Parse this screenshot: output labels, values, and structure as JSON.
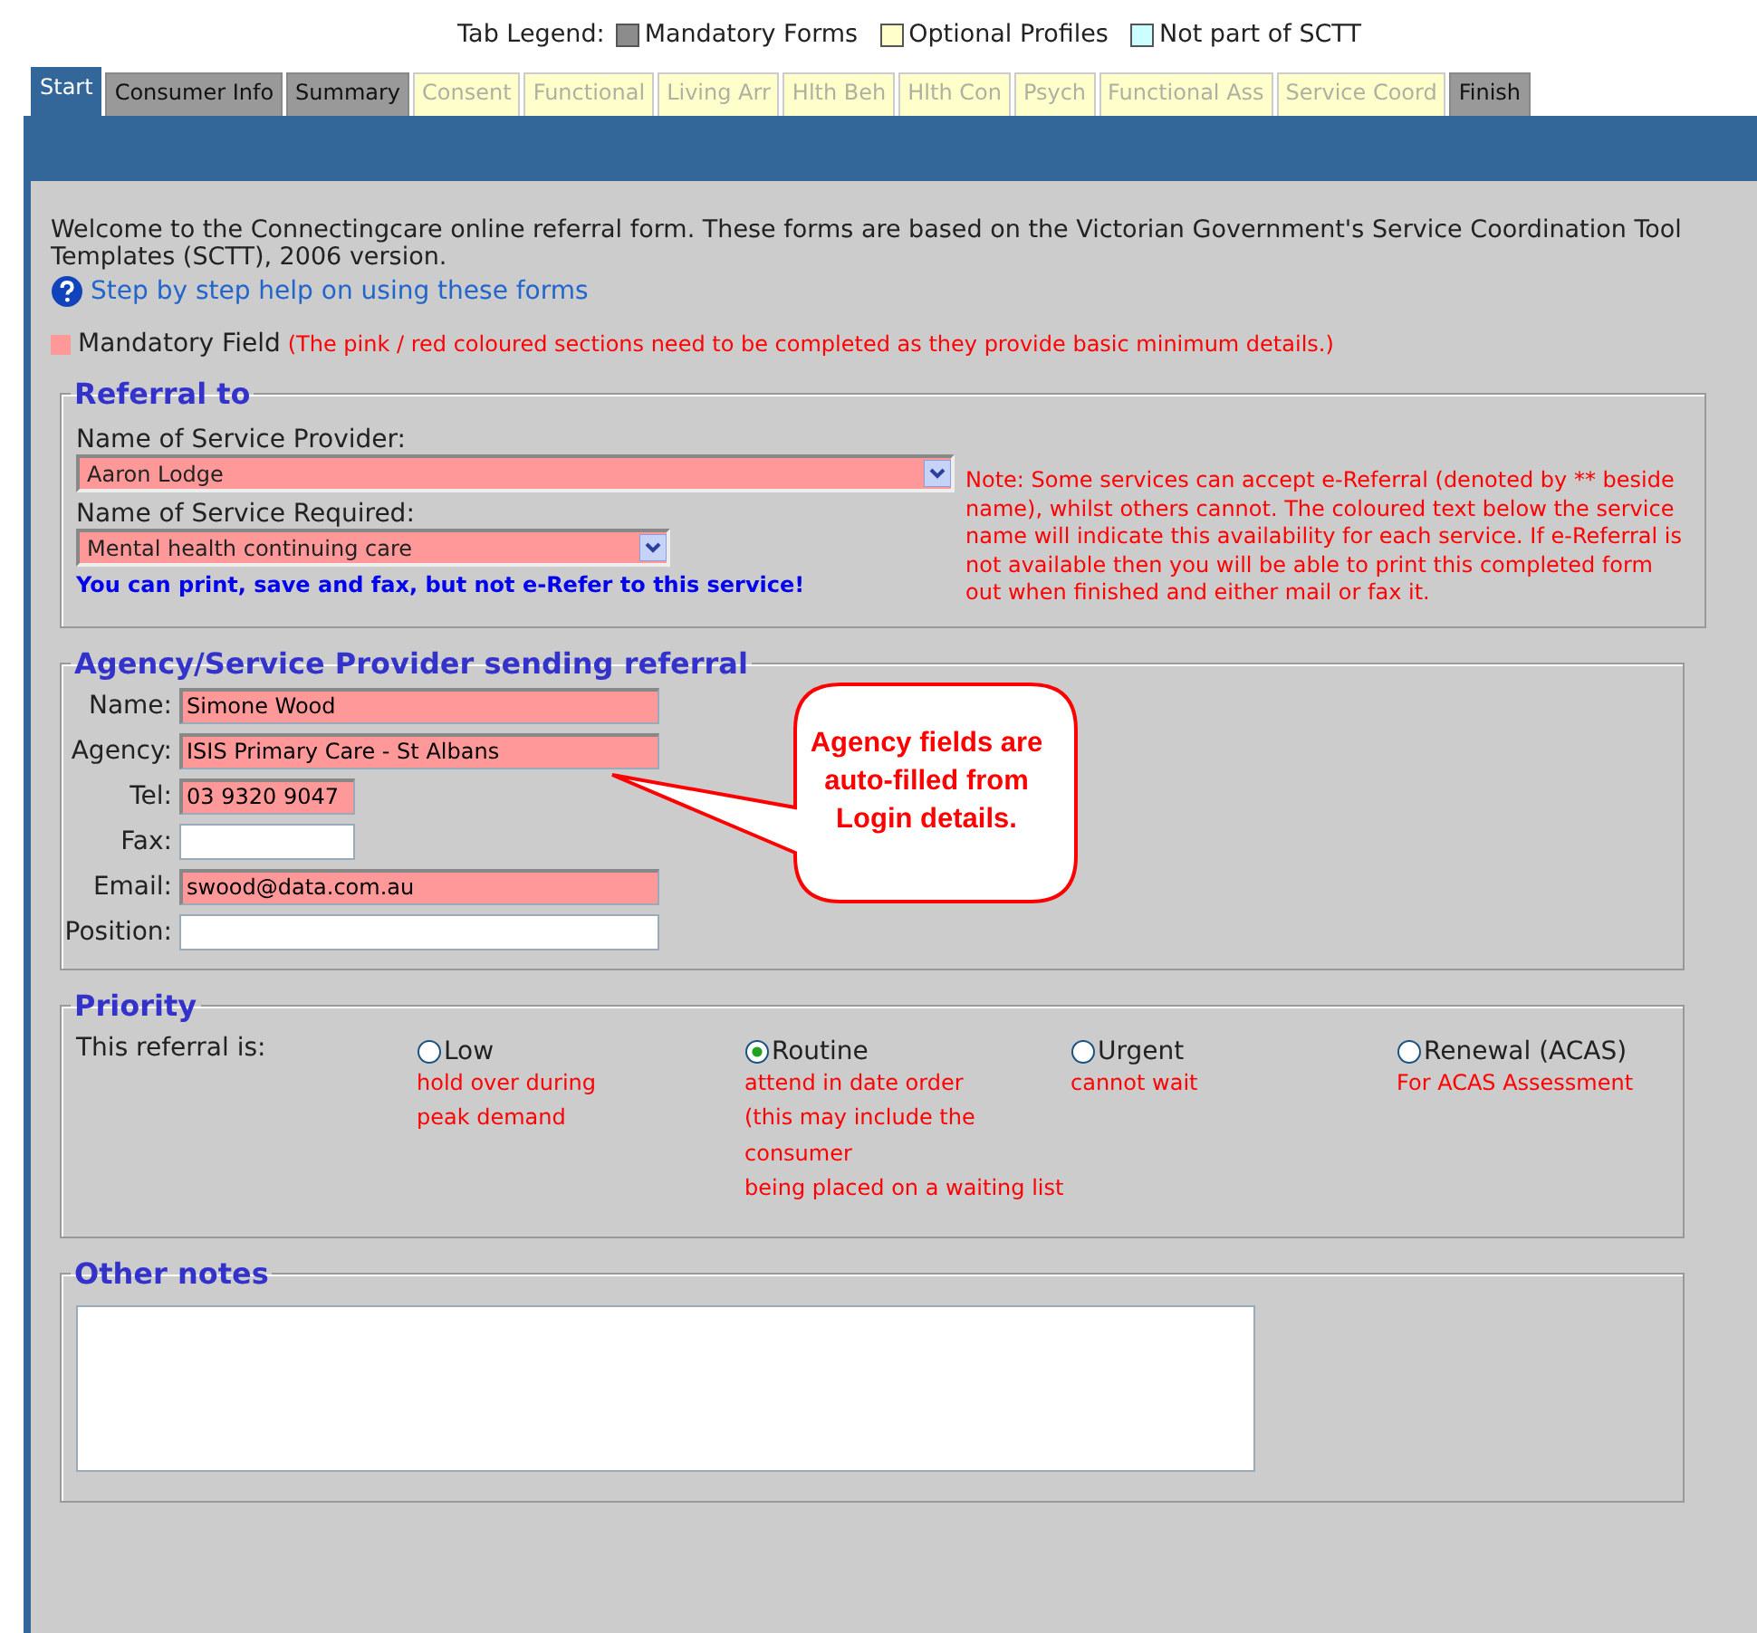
{
  "legend": {
    "label": "Tab Legend:",
    "items": [
      {
        "kind": "mandatory",
        "label": "Mandatory Forms"
      },
      {
        "kind": "optional",
        "label": "Optional Profiles"
      },
      {
        "kind": "external",
        "label": "Not part of SCTT"
      }
    ]
  },
  "tabs": [
    {
      "label": "Start",
      "kind": "mandatory",
      "selected": true
    },
    {
      "label": "Consumer Info",
      "kind": "mandatory",
      "selected": false
    },
    {
      "label": "Summary",
      "kind": "mandatory",
      "selected": false
    },
    {
      "label": "Consent",
      "kind": "optional",
      "selected": false
    },
    {
      "label": "Functional",
      "kind": "optional",
      "selected": false
    },
    {
      "label": "Living Arr",
      "kind": "optional",
      "selected": false
    },
    {
      "label": "Hlth Beh",
      "kind": "optional",
      "selected": false
    },
    {
      "label": "Hlth Con",
      "kind": "optional",
      "selected": false
    },
    {
      "label": "Psych",
      "kind": "optional",
      "selected": false
    },
    {
      "label": "Functional Ass",
      "kind": "optional",
      "selected": false
    },
    {
      "label": "Service Coord",
      "kind": "optional",
      "selected": false
    },
    {
      "label": "Finish",
      "kind": "mandatory",
      "selected": false
    }
  ],
  "intro": {
    "text": "Welcome to the Connectingcare online referral form. These forms are based on the Victorian Government's Service Coordination Tool Templates (SCTT), 2006 version.",
    "help_link": "Step by step help on using these forms"
  },
  "mandatory_key": {
    "label": "Mandatory Field",
    "note": "(The pink / red coloured sections need to be completed as they provide basic minimum details.)"
  },
  "referral": {
    "title": "Referral to",
    "fields": [
      {
        "label": "Name of Service Provider:",
        "value": "Aaron Lodge",
        "required": true
      },
      {
        "label": "Name of Service Required:",
        "value": "Mental health continuing care",
        "required": true
      }
    ],
    "message": "You can print, save and fax, but not e-Refer to this service!",
    "note": "Note: Some services can accept e-Referral (denoted by ** beside name), whilst others cannot. The coloured text below the service name will indicate this availability for each service. If e-Referral is not available then you will be able to print this completed form out when finished and either mail or fax it."
  },
  "agency": {
    "title": "Agency/Service Provider sending referral",
    "fields": [
      {
        "label": "Name:",
        "value": "Simone Wood",
        "required": true,
        "kind": "long"
      },
      {
        "label": "Agency:",
        "value": "ISIS Primary Care - St Albans",
        "required": true,
        "kind": "long"
      },
      {
        "label": "Tel:",
        "value": "03 9320 9047",
        "required": true,
        "kind": "short"
      },
      {
        "label": "Fax:",
        "required": false,
        "kind": "short"
      },
      {
        "label": "Email:",
        "value": "swood@data.com.au",
        "required": true,
        "kind": "long"
      },
      {
        "label": "Position:",
        "required": false,
        "kind": "long"
      }
    ],
    "callout": "Agency fields are auto-filled from Login details."
  },
  "priority": {
    "title": "Priority",
    "label": "This referral is:",
    "options": [
      {
        "label": "Low",
        "selected": false,
        "description": [
          "hold over during",
          "peak demand"
        ]
      },
      {
        "label": "Routine",
        "selected": true,
        "description": [
          "attend in date order",
          "(this may include the",
          "consumer",
          "being placed on a waiting list"
        ]
      },
      {
        "label": "Urgent",
        "selected": false,
        "description": [
          "cannot wait"
        ]
      },
      {
        "label": "Renewal (ACAS)",
        "selected": false,
        "description": [
          "For ACAS Assessment"
        ]
      }
    ]
  },
  "notes": {
    "title": "Other notes"
  }
}
